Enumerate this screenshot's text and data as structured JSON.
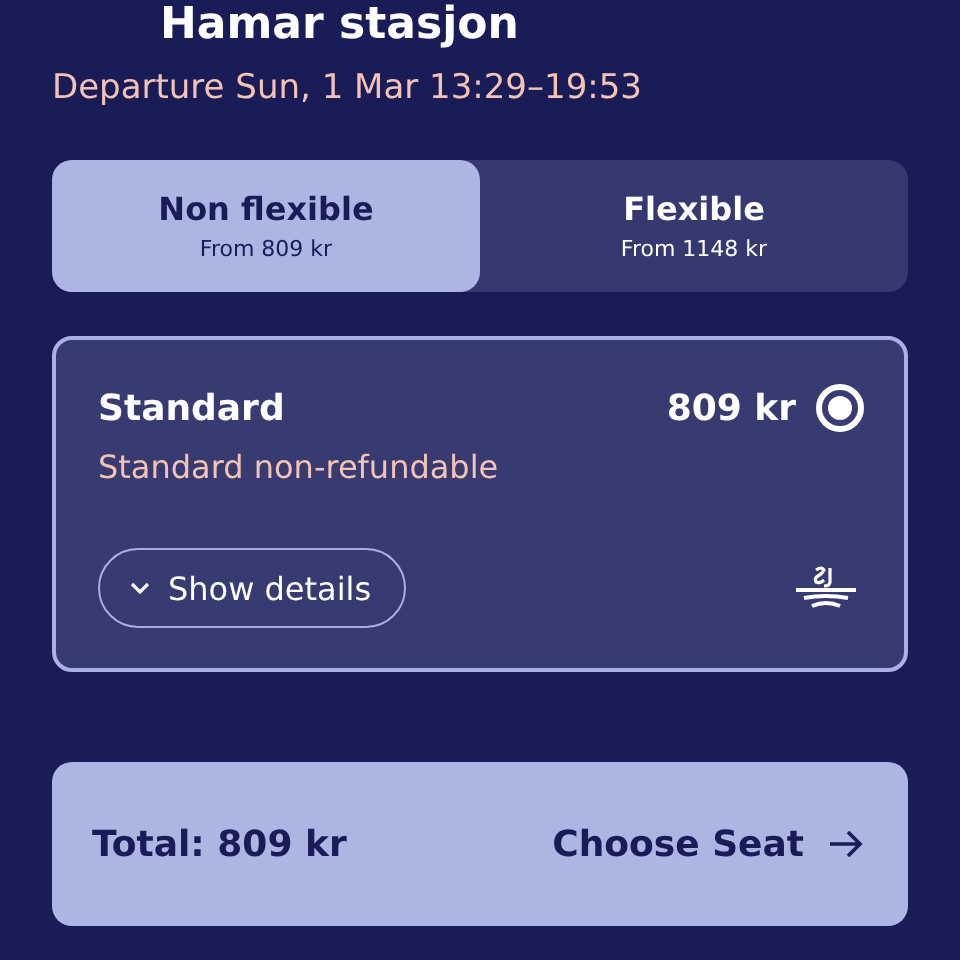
{
  "header": {
    "title": "Hamar stasjon",
    "departure": "Departure Sun, 1 Mar 13:29–19:53"
  },
  "fare_types": [
    {
      "label": "Non flexible",
      "price": "From 809 kr",
      "selected": true
    },
    {
      "label": "Flexible",
      "price": "From 1148 kr",
      "selected": false
    }
  ],
  "offers": [
    {
      "name": "Standard",
      "price": "809 kr",
      "selected": true,
      "description": "Standard non-refundable",
      "details_button": "Show details",
      "expanded": false
    }
  ],
  "footer": {
    "total": "Total: 809 kr",
    "action": "Choose Seat"
  }
}
